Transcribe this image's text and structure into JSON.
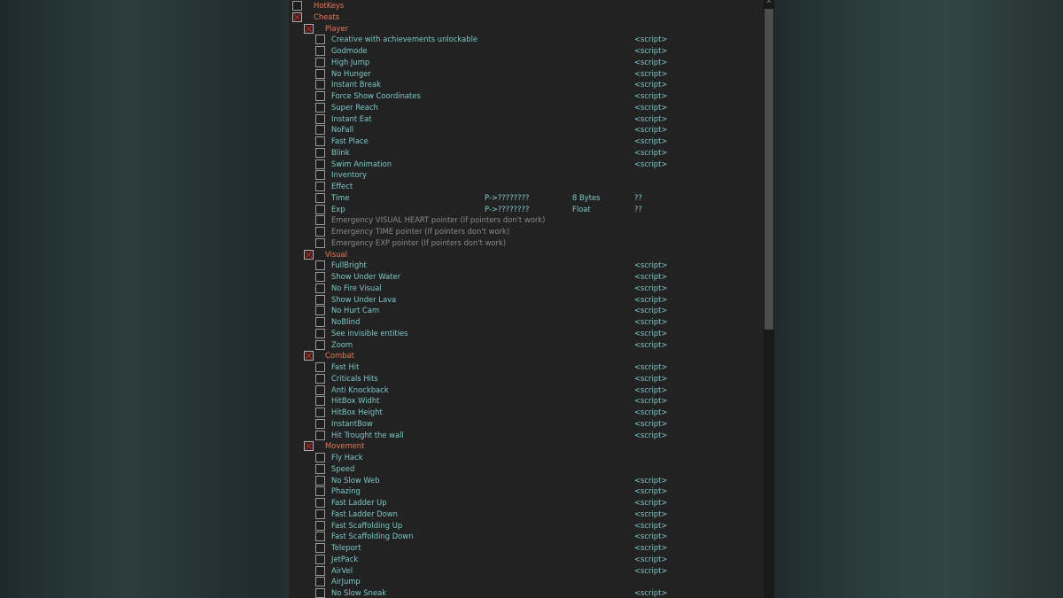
{
  "colors": {
    "item": "#7ec8c8",
    "header": "#e8795a",
    "disabled": "#8a8a8a",
    "panel": "#222222"
  },
  "rows": [
    {
      "label": "HotKeys",
      "level": 0,
      "header": true,
      "checked": false
    },
    {
      "label": "Cheats",
      "level": 0,
      "header": true,
      "checked": true
    },
    {
      "label": "Player",
      "level": 1,
      "header": true,
      "checked": true
    },
    {
      "label": "Creative with achievements unlockable",
      "level": 2,
      "value": "<script>"
    },
    {
      "label": "Godmode",
      "level": 2,
      "value": "<script>"
    },
    {
      "label": "High Jump",
      "level": 2,
      "value": "<script>"
    },
    {
      "label": "No Hunger",
      "level": 2,
      "value": "<script>"
    },
    {
      "label": "Instant Break",
      "level": 2,
      "value": "<script>"
    },
    {
      "label": "Force Show Coordinates",
      "level": 2,
      "value": "<script>"
    },
    {
      "label": "Super Reach",
      "level": 2,
      "value": "<script>"
    },
    {
      "label": "Instant Eat",
      "level": 2,
      "value": "<script>"
    },
    {
      "label": "NoFall",
      "level": 2,
      "value": "<script>"
    },
    {
      "label": "Fast Place",
      "level": 2,
      "value": "<script>"
    },
    {
      "label": "Blink",
      "level": 2,
      "value": "<script>"
    },
    {
      "label": "Swim Animation",
      "level": 2,
      "value": "<script>"
    },
    {
      "label": "Inventory",
      "level": 2
    },
    {
      "label": "Effect",
      "level": 2
    },
    {
      "label": "Time",
      "level": 2,
      "address": "P->????????",
      "type": "8 Bytes",
      "value": "??"
    },
    {
      "label": "Exp",
      "level": 2,
      "address": "P->????????",
      "type": "Float",
      "value": "??"
    },
    {
      "label": "Emergency VISUAL HEART pointer (If pointers don't work)",
      "level": 2,
      "disabled": true
    },
    {
      "label": "Emergency TIME pointer (If pointers don't work)",
      "level": 2,
      "disabled": true
    },
    {
      "label": "Emergency EXP pointer (If pointers don't work)",
      "level": 2,
      "disabled": true
    },
    {
      "label": "Visual",
      "level": 1,
      "header": true,
      "checked": true
    },
    {
      "label": "FullBright",
      "level": 2,
      "value": "<script>"
    },
    {
      "label": "Show Under Water",
      "level": 2,
      "value": "<script>"
    },
    {
      "label": "No Fire Visual",
      "level": 2,
      "value": "<script>"
    },
    {
      "label": "Show Under Lava",
      "level": 2,
      "value": "<script>"
    },
    {
      "label": "No Hurt Cam",
      "level": 2,
      "value": "<script>"
    },
    {
      "label": "NoBlind",
      "level": 2,
      "value": "<script>"
    },
    {
      "label": "See invisible entities",
      "level": 2,
      "value": "<script>"
    },
    {
      "label": "Zoom",
      "level": 2,
      "value": "<script>"
    },
    {
      "label": "Combat",
      "level": 1,
      "header": true,
      "checked": true
    },
    {
      "label": "Fast Hit",
      "level": 2,
      "value": "<script>"
    },
    {
      "label": "Criticals Hits",
      "level": 2,
      "value": "<script>"
    },
    {
      "label": "Anti Knockback",
      "level": 2,
      "value": "<script>"
    },
    {
      "label": "HitBox Widht",
      "level": 2,
      "value": "<script>"
    },
    {
      "label": "HitBox Height",
      "level": 2,
      "value": "<script>"
    },
    {
      "label": "InstantBow",
      "level": 2,
      "value": "<script>"
    },
    {
      "label": "Hit Trought the wall",
      "level": 2,
      "value": "<script>"
    },
    {
      "label": "Movement",
      "level": 1,
      "header": true,
      "checked": true
    },
    {
      "label": "Fly Hack",
      "level": 2
    },
    {
      "label": "Speed",
      "level": 2
    },
    {
      "label": "No Slow Web",
      "level": 2,
      "value": "<script>"
    },
    {
      "label": "Phazing",
      "level": 2,
      "value": "<script>"
    },
    {
      "label": "Fast Ladder Up",
      "level": 2,
      "value": "<script>"
    },
    {
      "label": "Fast Ladder Down",
      "level": 2,
      "value": "<script>"
    },
    {
      "label": "Fast Scaffolding Up",
      "level": 2,
      "value": "<script>"
    },
    {
      "label": "Fast Scaffolding Down",
      "level": 2,
      "value": "<script>"
    },
    {
      "label": "Teleport",
      "level": 2,
      "value": "<script>"
    },
    {
      "label": "JetPack",
      "level": 2,
      "value": "<script>"
    },
    {
      "label": "AirVel",
      "level": 2,
      "value": "<script>"
    },
    {
      "label": "AirJump",
      "level": 2
    },
    {
      "label": "No Slow Sneak",
      "level": 2,
      "value": "<script>"
    }
  ]
}
